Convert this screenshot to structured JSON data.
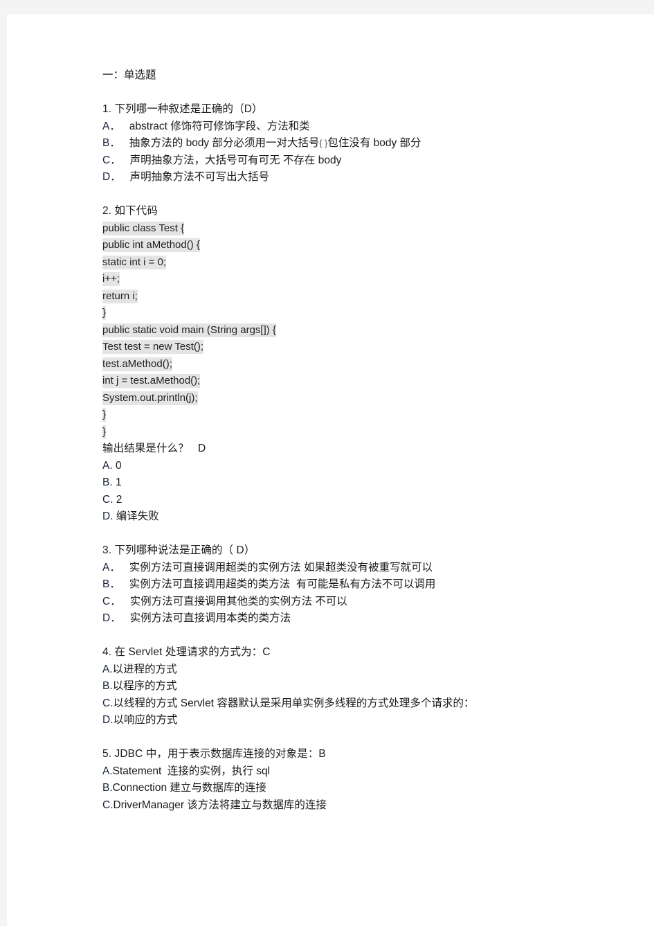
{
  "document": {
    "section_heading": "一：单选题",
    "questions": [
      {
        "id": "q1",
        "stem": "1. 下列哪一种叙述是正确的（D）",
        "options": [
          {
            "label": "A．",
            "text": "abstract 修饰符可修饰字段、方法和类"
          },
          {
            "label": "B．",
            "text": "抽象方法的 body 部分必须用一对大括号",
            "brace": "{ }",
            "text_after": "包住没有 body 部分"
          },
          {
            "label": "C．",
            "text": "声明抽象方法，大括号可有可无 不存在 body"
          },
          {
            "label": "D．",
            "text": "声明抽象方法不可写出大括号"
          }
        ]
      },
      {
        "id": "q2",
        "stem": "2. 如下代码",
        "code_lines": [
          "public class Test {",
          "public int aMethod() {",
          "static int i = 0;",
          "i++;",
          "return i;",
          "}",
          "public static void main (String args[]) {",
          "Test test = new Test();",
          "test.aMethod();",
          "int j = test.aMethod();",
          "System.out.println(j);",
          "}",
          "}"
        ],
        "sub_stem": "输出结果是什么？   D",
        "options": [
          {
            "label": "A.",
            "text": " 0"
          },
          {
            "label": "B.",
            "text": " 1"
          },
          {
            "label": "C.",
            "text": " 2"
          },
          {
            "label": "D.",
            "text": " 编译失败"
          }
        ]
      },
      {
        "id": "q3",
        "stem": "3. 下列哪种说法是正确的（ D）",
        "options": [
          {
            "label": "A．",
            "text": "实例方法可直接调用超类的实例方法 如果超类没有被重写就可以"
          },
          {
            "label": "B．",
            "text": "实例方法可直接调用超类的类方法  有可能是私有方法不可以调用"
          },
          {
            "label": "C．",
            "text": "实例方法可直接调用其他类的实例方法 不可以"
          },
          {
            "label": "D．",
            "text": "实例方法可直接调用本类的类方法"
          }
        ]
      },
      {
        "id": "q4",
        "stem": "4. 在 Servlet 处理请求的方式为：C",
        "options": [
          {
            "label": "A.",
            "text": "以进程的方式"
          },
          {
            "label": "B.",
            "text": "以程序的方式"
          },
          {
            "label": "C.",
            "text": "以线程的方式 Servlet 容器默认是采用单实例多线程的方式处理多个请求的："
          },
          {
            "label": "D.",
            "text": "以响应的方式"
          }
        ]
      },
      {
        "id": "q5",
        "stem": "5. JDBC 中，用于表示数据库连接的对象是：B",
        "options": [
          {
            "label": "A.",
            "text": "Statement  连接的实例，执行 sql"
          },
          {
            "label": "B.",
            "text": "Connection 建立与数据库的连接"
          },
          {
            "label": "C.",
            "text": "DriverManager 该方法将建立与数据库的连接"
          }
        ]
      }
    ]
  },
  "colors": {
    "page_background": "#ffffff",
    "canvas_background": "#f4f4f4",
    "code_highlight": "#e4e4e4",
    "text": "#1a1a1a",
    "label": "#16213c"
  }
}
